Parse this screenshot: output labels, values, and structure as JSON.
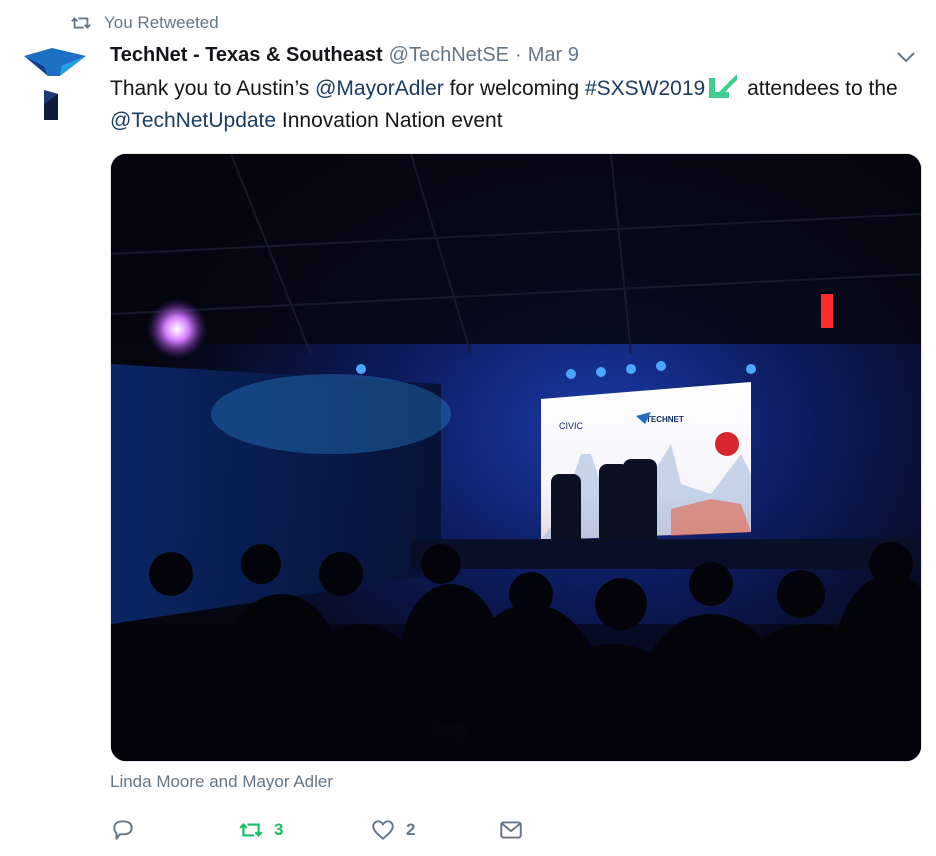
{
  "retweet_banner": {
    "label": "You Retweeted"
  },
  "tweet": {
    "author_name": "TechNet - Texas & Southeast",
    "author_handle": "@TechNetSE",
    "separator": "·",
    "date": "Mar 9",
    "text_parts": {
      "p1": "Thank you to Austin’s ",
      "mention1": "@MayorAdler",
      "p2": " for welcoming ",
      "hashtag": "#SXSW2019",
      "p3": " attendees to the ",
      "mention2": "@TechNetUpdate",
      "p4": " Innovation Nation event"
    },
    "tagged_people": "Linda Moore and Mayor Adler"
  },
  "actions": {
    "reply_count": "",
    "retweet_count": "3",
    "like_count": "2"
  },
  "colors": {
    "accent": "#1b95e0",
    "retweet_active": "#17bf63",
    "muted": "#657786",
    "hashflag": "#3ecf8e"
  }
}
